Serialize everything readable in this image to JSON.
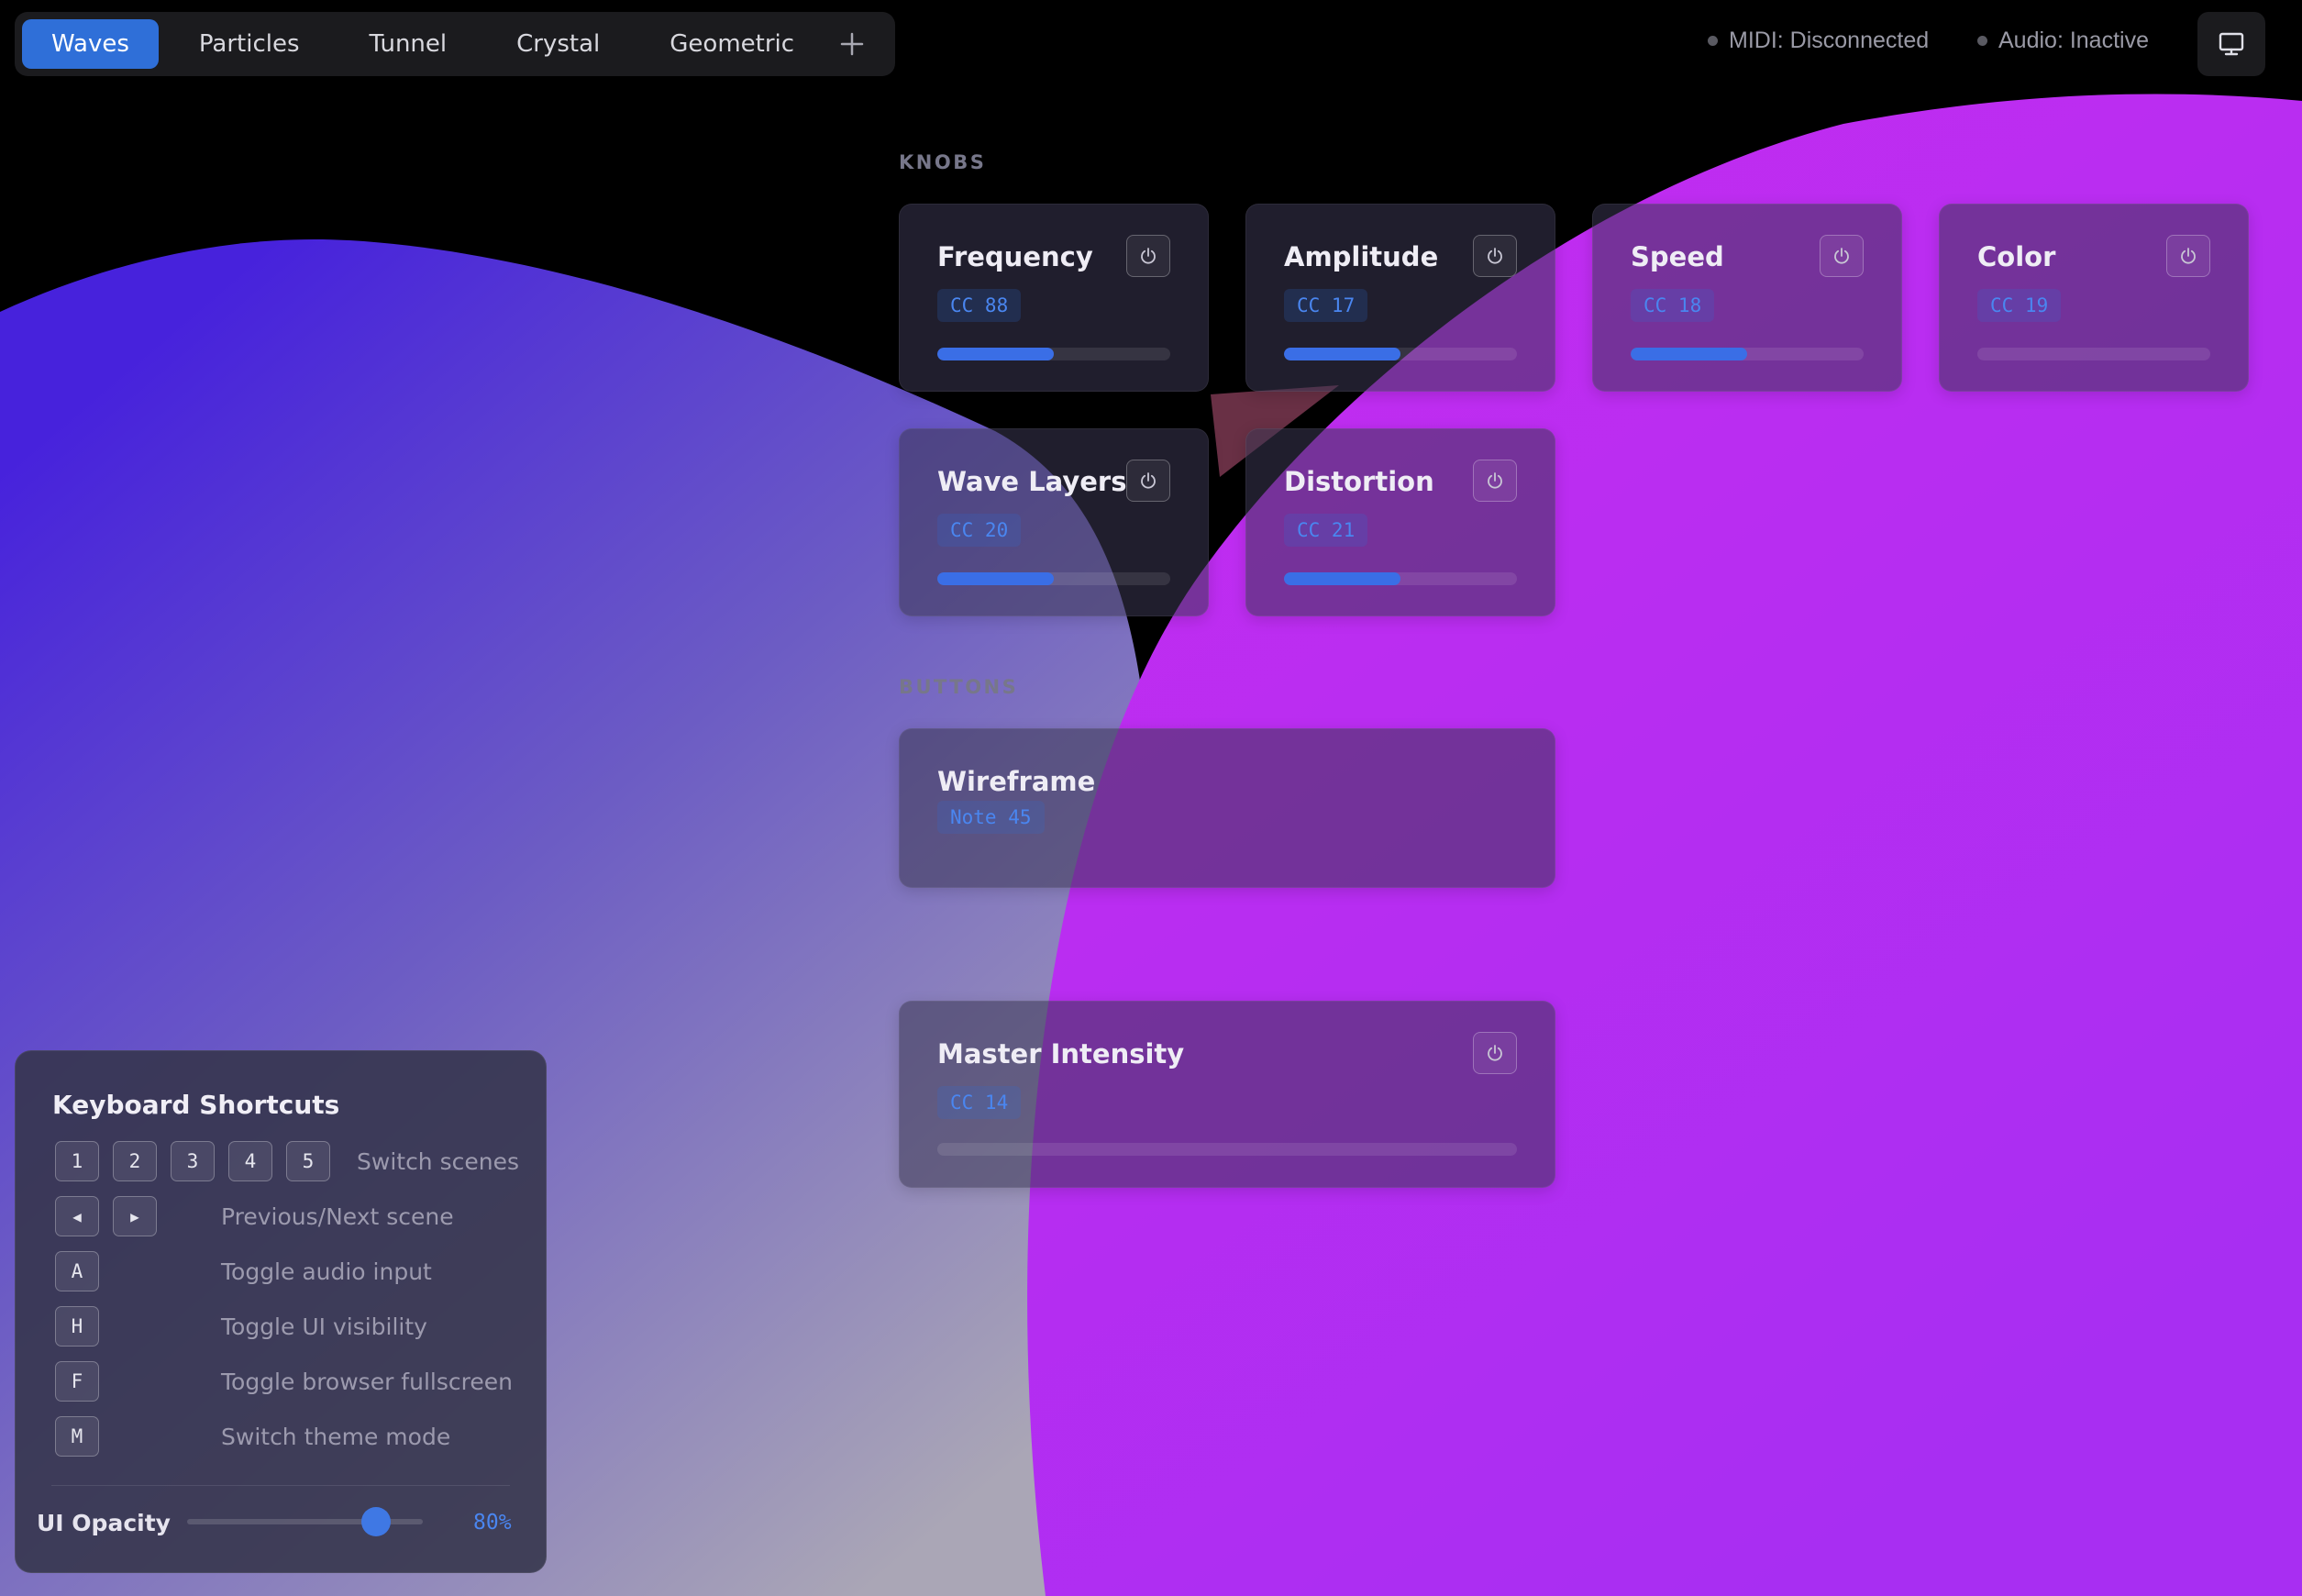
{
  "scenes": {
    "tabs": [
      "Waves",
      "Particles",
      "Tunnel",
      "Crystal",
      "Geometric"
    ],
    "active": "Waves",
    "add_icon": "plus-icon"
  },
  "status": {
    "midi": "MIDI: Disconnected",
    "audio": "Audio: Inactive",
    "monitor_icon": "monitor-icon"
  },
  "sections": {
    "knobs": "KNOBS",
    "buttons": "BUTTONS"
  },
  "knobs": [
    {
      "label": "Frequency",
      "cc": "CC 88",
      "level": 0.5
    },
    {
      "label": "Amplitude",
      "cc": "CC 17",
      "level": 0.5
    },
    {
      "label": "Speed",
      "cc": "CC 18",
      "level": 0.5
    },
    {
      "label": "Color",
      "cc": "CC 19",
      "level": 0.0
    },
    {
      "label": "Wave Layers",
      "cc": "CC 20",
      "level": 0.5
    },
    {
      "label": "Distortion",
      "cc": "CC 21",
      "level": 0.5
    }
  ],
  "buttons": [
    {
      "label": "Wireframe",
      "note": "Note 45"
    }
  ],
  "master": {
    "label": "Master Intensity",
    "cc": "CC 14",
    "level": 0.0
  },
  "shortcuts": {
    "title": "Keyboard Shortcuts",
    "scene_keys": [
      "1",
      "2",
      "3",
      "4",
      "5"
    ],
    "scene_desc": "Switch scenes",
    "nav_keys": [
      "◀",
      "▶"
    ],
    "nav_desc": "Previous/Next scene",
    "audio_key": "A",
    "audio_desc": "Toggle audio input",
    "ui_key": "H",
    "ui_desc": "Toggle UI visibility",
    "fullscreen_key": "F",
    "fullscreen_desc": "Toggle browser fullscreen",
    "theme_key": "M",
    "theme_desc": "Switch theme mode",
    "opacity_label": "UI Opacity",
    "opacity_value": "80%",
    "opacity_level": 0.8
  },
  "colors": {
    "accent": "#2f6fd8",
    "bar_fill": "#3a6ee6",
    "wave_blue": "#4a2de0",
    "wave_magenta": "#c42ef2"
  }
}
